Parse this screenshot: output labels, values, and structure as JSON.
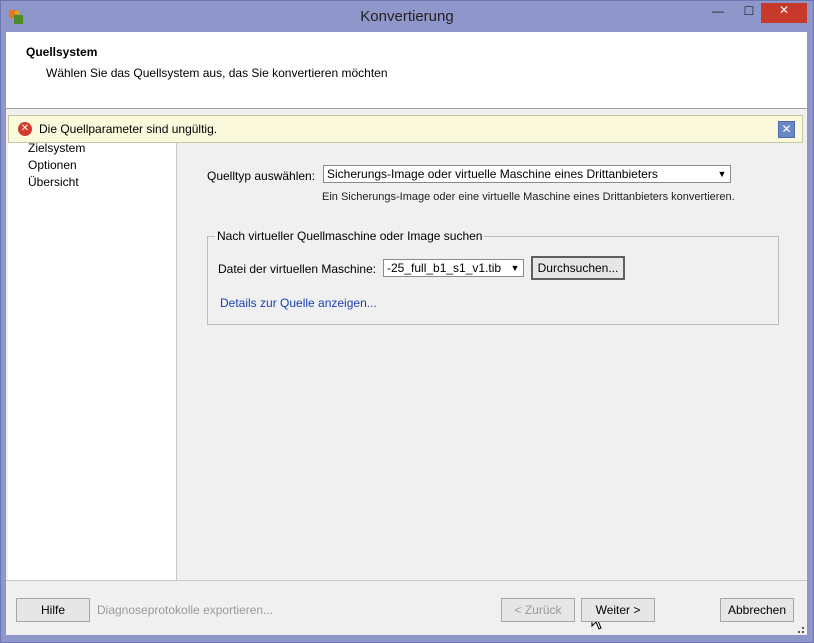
{
  "window": {
    "title": "Konvertierung",
    "min_glyph": "—",
    "max_glyph": "☐",
    "close_glyph": "✕"
  },
  "header": {
    "title": "Quellsystem",
    "subtitle": "Wählen Sie das Quellsystem aus, das Sie konvertieren möchten"
  },
  "error": {
    "icon_glyph": "✕",
    "message": "Die Quellparameter sind ungültig.",
    "close_glyph": "✕"
  },
  "sidebar": {
    "items": [
      {
        "label": "Zielsystem"
      },
      {
        "label": "Optionen"
      },
      {
        "label": "Übersicht"
      }
    ]
  },
  "source": {
    "type_label": "Quelltyp auswählen:",
    "type_value": "Sicherungs-Image oder virtuelle Maschine eines Drittanbieters",
    "type_hint": "Ein Sicherungs-Image oder eine virtuelle Maschine eines Drittanbieters konvertieren.",
    "group_title": "Nach virtueller Quellmaschine oder Image suchen",
    "file_label": "Datei der virtuellen Maschine:",
    "file_value": "-25_full_b1_s1_v1.tib",
    "browse_label": "Durchsuchen...",
    "details_link": "Details zur Quelle anzeigen..."
  },
  "footer": {
    "help_label": "Hilfe",
    "export_logs_label": "Diagnoseprotokolle exportieren...",
    "back_label": "< Zurück",
    "next_label": "Weiter >",
    "cancel_label": "Abbrechen"
  },
  "colors": {
    "title_bar": "#8f96c9",
    "close_button": "#c7392b",
    "error_background": "#fbf9dc",
    "error_icon": "#d33b2f",
    "link": "#1a3fb0"
  },
  "icons": {
    "app": "app-icon",
    "error": "error-icon",
    "dropdown": "chevron-down-icon"
  }
}
